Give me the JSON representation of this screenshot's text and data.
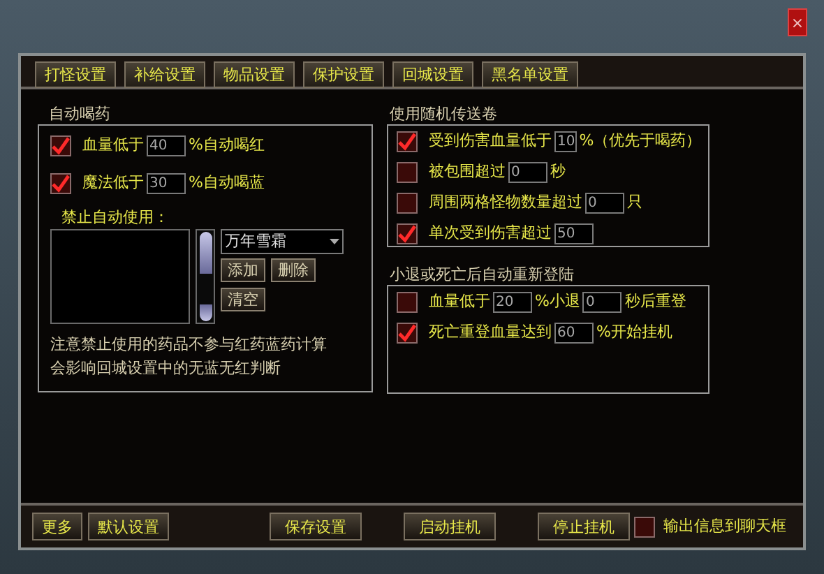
{
  "close_button": "×",
  "tabs": [
    "打怪设置",
    "补给设置",
    "物品设置",
    "保护设置",
    "回城设置",
    "黑名单设置"
  ],
  "auto_potion": {
    "title": "自动喝药",
    "rows": [
      {
        "checked": true,
        "parts": [
          {
            "kind": "text",
            "text": "血量低于"
          },
          {
            "kind": "field",
            "value": "40"
          },
          {
            "kind": "text",
            "text": "%自动喝红"
          }
        ]
      },
      {
        "checked": true,
        "parts": [
          {
            "kind": "text",
            "text": "魔法低于"
          },
          {
            "kind": "field",
            "value": "30"
          },
          {
            "kind": "text",
            "text": "%自动喝蓝"
          }
        ]
      }
    ],
    "forbid_label": "禁止自动使用：",
    "dropdown": {
      "value": "万年雪霜"
    },
    "buttons": [
      "添加",
      "删除",
      "清空"
    ],
    "notes": [
      "注意禁止使用的药品不参与红药蓝药计算",
      "会影响回城设置中的无蓝无红判断"
    ]
  },
  "random_teleport": {
    "title": "使用随机传送卷",
    "rows": [
      {
        "checked": true,
        "parts": [
          {
            "kind": "text",
            "text": "受到伤害血量低于"
          },
          {
            "kind": "field",
            "value": "10"
          },
          {
            "kind": "text",
            "text": "%（优先于喝药）"
          }
        ]
      },
      {
        "checked": false,
        "parts": [
          {
            "kind": "text",
            "text": "被包围超过"
          },
          {
            "kind": "field",
            "value": "0"
          },
          {
            "kind": "text",
            "text": "秒"
          }
        ]
      },
      {
        "checked": false,
        "parts": [
          {
            "kind": "text",
            "text": "周围两格怪物数量超过"
          },
          {
            "kind": "field",
            "value": "0"
          },
          {
            "kind": "text",
            "text": "只"
          }
        ]
      },
      {
        "checked": true,
        "parts": [
          {
            "kind": "text",
            "text": "单次受到伤害超过"
          },
          {
            "kind": "field",
            "value": "50"
          }
        ]
      }
    ]
  },
  "relogin": {
    "title": "小退或死亡后自动重新登陆",
    "rows": [
      {
        "checked": false,
        "parts": [
          {
            "kind": "text",
            "text": "血量低于"
          },
          {
            "kind": "field",
            "value": "20"
          },
          {
            "kind": "text",
            "text": "%小退"
          },
          {
            "kind": "field",
            "value": "0"
          },
          {
            "kind": "text",
            "text": "秒后重登"
          }
        ]
      },
      {
        "checked": true,
        "parts": [
          {
            "kind": "text",
            "text": "死亡重登血量达到"
          },
          {
            "kind": "field",
            "value": "60"
          },
          {
            "kind": "text",
            "text": "%开始挂机"
          }
        ]
      }
    ]
  },
  "bottom_bar": {
    "left_buttons": [
      "更多",
      "默认设置"
    ],
    "center_buttons": [
      "保存设置",
      "启动挂机",
      "停止挂机"
    ],
    "chat_output": {
      "checked": false,
      "label": "输出信息到聊天框"
    }
  }
}
